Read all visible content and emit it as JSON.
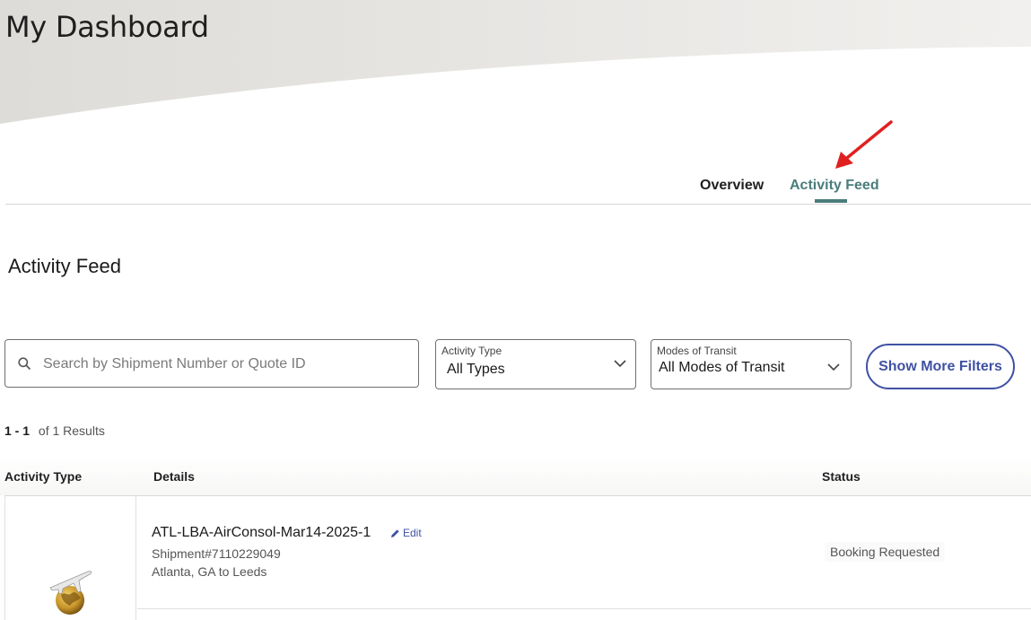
{
  "header": {
    "title": "My Dashboard"
  },
  "tabs": [
    {
      "label": "Overview",
      "active": false
    },
    {
      "label": "Activity Feed",
      "active": true
    }
  ],
  "section": {
    "title": "Activity Feed"
  },
  "filters": {
    "search": {
      "placeholder": "Search by Shipment Number or Quote ID",
      "value": ""
    },
    "activity_type": {
      "label": "Activity Type",
      "value": "All Types"
    },
    "modes_of_transit": {
      "label": "Modes of Transit",
      "value": "All Modes of Transit"
    },
    "more_filters_label": "Show More Filters"
  },
  "results": {
    "range": "1 - 1",
    "total_text": "of 1 Results"
  },
  "table": {
    "columns": [
      "Activity Type",
      "Details",
      "Status"
    ],
    "rows": [
      {
        "icon": "air-shipment-icon",
        "name": "ATL-LBA-AirConsol-Mar14-2025-1",
        "edit_label": "Edit",
        "shipment_number": "Shipment#7110229049",
        "route": "Atlanta, GA to Leeds",
        "status": "Booking Requested"
      }
    ]
  },
  "colors": {
    "accent_teal": "#4a7c7b",
    "primary_blue": "#3f51a3",
    "annotation_red": "#e02020"
  }
}
